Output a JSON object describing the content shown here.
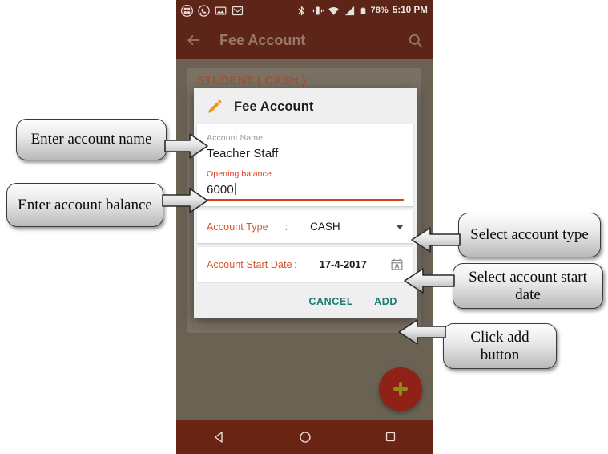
{
  "status_bar": {
    "left_icons": [
      "apps-grid-icon",
      "whatsapp-icon",
      "gallery-image-icon",
      "gmail-icon"
    ],
    "right_icons": [
      "bluetooth-icon",
      "vibrate-icon",
      "wifi-icon",
      "signal-icon",
      "battery-icon"
    ],
    "battery_percent": "78%",
    "time": "5:10 PM"
  },
  "app_bar": {
    "back_icon": "back-arrow-icon",
    "title": "Fee Account",
    "search_icon": "search-icon"
  },
  "background": {
    "card_title": "STUDENT ( CASH )",
    "fab_icon": "plus-icon"
  },
  "nav_bar": {
    "back_icon": "triangle-back-icon",
    "home_icon": "circle-home-icon",
    "recents_icon": "square-recents-icon"
  },
  "dialog": {
    "header_icon": "pencil-edit-icon",
    "title": "Fee Account",
    "fields": {
      "account_name": {
        "label": "Account Name",
        "value": "Teacher Staff",
        "focused": false
      },
      "opening_balance": {
        "label": "Opening balance",
        "value": "6000",
        "focused": true
      }
    },
    "rows": [
      {
        "label": "Account Type",
        "separator": ":",
        "value": "CASH",
        "trailing_icon": "dropdown-caret-icon"
      },
      {
        "label": "Account Start Date",
        "separator": ":",
        "value": "17-4-2017",
        "trailing_icon": "calendar-icon"
      }
    ],
    "actions": {
      "cancel_label": "CANCEL",
      "add_label": "ADD"
    }
  },
  "annotations": [
    {
      "id": "enter-account-name",
      "text": "Enter account name"
    },
    {
      "id": "enter-account-balance",
      "text": "Enter account balance"
    },
    {
      "id": "select-account-type",
      "text": "Select account type"
    },
    {
      "id": "select-account-start-date",
      "text": "Select account start date"
    },
    {
      "id": "click-add-button",
      "text": "Click add button"
    }
  ],
  "colors": {
    "app_bar": "#5c2517",
    "accent_orange": "#d6542b",
    "focus_red": "#e03a22",
    "action_teal": "#1d7c72",
    "fab": "#8f2116",
    "scrim": "#6b6254"
  }
}
